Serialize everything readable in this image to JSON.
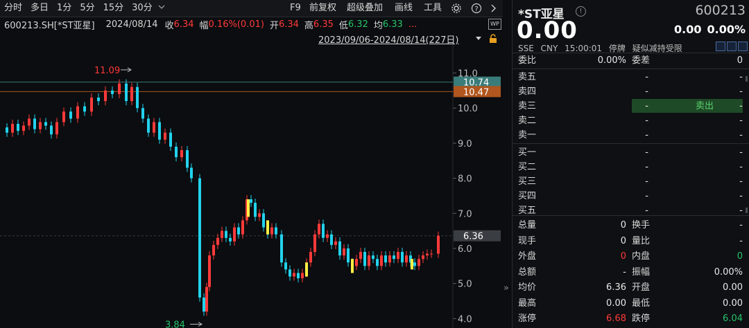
{
  "toolbar": {
    "periods": [
      "分时",
      "多日",
      "1分",
      "5分",
      "15分",
      "30分"
    ],
    "selected_dropdown_icon": "chevron-down-icon",
    "right_items": [
      "F9",
      "前复权",
      "超级叠加",
      "画线",
      "工具"
    ],
    "icons": [
      "gear-icon",
      "help-icon",
      "chevron-right-icon"
    ]
  },
  "info_bar": {
    "code_name": "600213.SH[*ST亚星]",
    "date": "2024/08/14",
    "close_label": "收",
    "close": "6.34",
    "amp_label": "幅",
    "amp": "0.16%(0.01)",
    "open_label": "开",
    "open": "6.34",
    "high_label": "高",
    "high": "6.35",
    "low_label": "低",
    "low": "6.32",
    "avg_label": "均",
    "avg": "6.33",
    "more": "...",
    "range": "2023/09/06-2024/08/14(227日)",
    "icons": [
      "wp-icon",
      "chevron-up-icon",
      "chevron-down-icon",
      "lock-icon"
    ]
  },
  "chart_data": {
    "type": "candlestick",
    "y_ticks": [
      "11.0",
      "10.0",
      "9.0",
      "8.0",
      "7.0",
      "6.0",
      "5.0",
      "4.0"
    ],
    "ylim": [
      3.85,
      11.7
    ],
    "price_tags": [
      {
        "value": 10.74,
        "text": "10.74",
        "color": "#3a7c7a"
      },
      {
        "value": 10.47,
        "text": "10.47",
        "color": "#b0561e"
      },
      {
        "value": 6.36,
        "text": "6.36",
        "color": "#3a3d42"
      }
    ],
    "annotations": [
      {
        "text": "11.09",
        "value": 11.09,
        "color": "#ff3a3a"
      },
      {
        "text": "3.84",
        "value": 3.84,
        "color": "#27c46a"
      }
    ],
    "colors": {
      "up": "#ff3a3a",
      "down": "#22d3ee",
      "grid": "#1f2226",
      "limit": "#ffee44"
    }
  },
  "quote": {
    "name": "*ST亚星",
    "info_icon": "info-icon",
    "code": "600213",
    "price": "0.00",
    "change": "0.00",
    "change_pct": "0.00%",
    "meta": [
      "SSE",
      "CNY",
      "15:00:01",
      "停牌",
      "疑似减持受限"
    ],
    "committee": {
      "ratio_label": "委比",
      "ratio": "0.00%",
      "diff_label": "委差",
      "diff": "0"
    },
    "asks": [
      {
        "label": "卖五",
        "price": "-",
        "vol": "-"
      },
      {
        "label": "卖四",
        "price": "-",
        "vol": "-"
      },
      {
        "label": "卖三",
        "price": "-",
        "vol": "-",
        "tag": "卖出"
      },
      {
        "label": "卖二",
        "price": "-",
        "vol": "-"
      },
      {
        "label": "卖一",
        "price": "-",
        "vol": "-"
      }
    ],
    "bids": [
      {
        "label": "买一",
        "price": "-",
        "vol": "-"
      },
      {
        "label": "买二",
        "price": "-",
        "vol": "-"
      },
      {
        "label": "买三",
        "price": "-",
        "vol": "-"
      },
      {
        "label": "买四",
        "price": "-",
        "vol": "-"
      },
      {
        "label": "买五",
        "price": "-",
        "vol": "-"
      }
    ],
    "stats": [
      [
        {
          "label": "总量",
          "value": "0"
        },
        {
          "label": "换手",
          "value": "-"
        }
      ],
      [
        {
          "label": "现手",
          "value": "0"
        },
        {
          "label": "量比",
          "value": "-"
        }
      ],
      [
        {
          "label": "外盘",
          "value": "0",
          "color": "#ff3a3a"
        },
        {
          "label": "内盘",
          "value": "0",
          "color": "#27c46a"
        }
      ],
      [
        {
          "label": "总额",
          "value": "-"
        },
        {
          "label": "振幅",
          "value": "0.00%"
        }
      ],
      [
        {
          "label": "均价",
          "value": "6.36"
        },
        {
          "label": "开盘",
          "value": "0.00"
        }
      ],
      [
        {
          "label": "最高",
          "value": "0.00"
        },
        {
          "label": "最低",
          "value": "0.00"
        }
      ],
      [
        {
          "label": "涨停",
          "value": "6.68",
          "color": "#ff3a3a"
        },
        {
          "label": "跌停",
          "value": "6.04",
          "color": "#27c46a"
        }
      ]
    ]
  }
}
